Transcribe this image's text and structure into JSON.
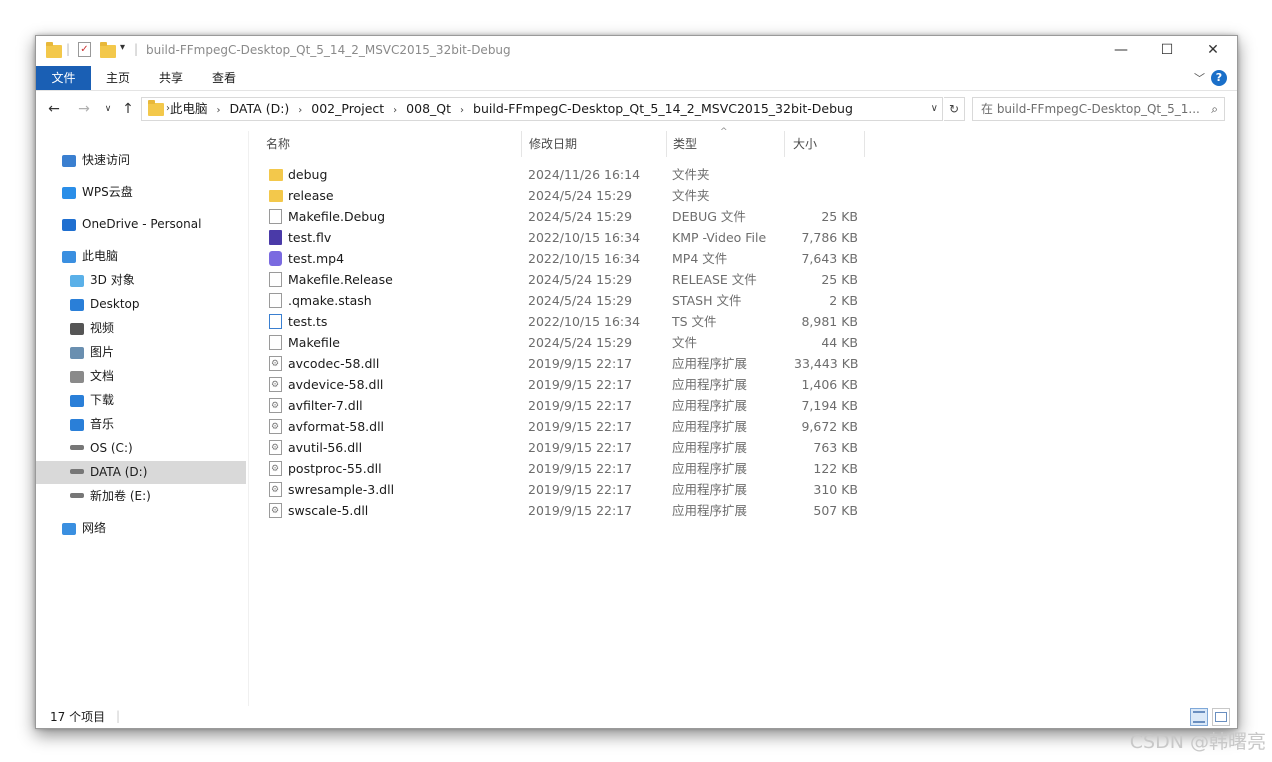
{
  "window": {
    "title": "build-FFmpegC-Desktop_Qt_5_14_2_MSVC2015_32bit-Debug",
    "controls": {
      "minimize": "—",
      "maximize": "☐",
      "close": "✕"
    }
  },
  "ribbon": {
    "tabs": [
      {
        "label": "文件",
        "active": true
      },
      {
        "label": "主页"
      },
      {
        "label": "共享"
      },
      {
        "label": "查看"
      }
    ],
    "help": "?"
  },
  "address": {
    "crumbs": [
      "此电脑",
      "DATA (D:)",
      "002_Project",
      "008_Qt",
      "build-FFmpegC-Desktop_Qt_5_14_2_MSVC2015_32bit-Debug"
    ],
    "search_placeholder": "在 build-FFmpegC-Desktop_Qt_5_1..."
  },
  "sidebar": {
    "items": [
      {
        "label": "快速访问",
        "icon": "star-icon"
      },
      {
        "label": "WPS云盘",
        "icon": "cloud-icon"
      },
      {
        "label": "OneDrive - Personal",
        "icon": "onedrive-icon"
      },
      {
        "label": "此电脑",
        "icon": "computer-icon"
      },
      {
        "label": "3D 对象",
        "icon": "3d-objects-icon"
      },
      {
        "label": "Desktop",
        "icon": "desktop-icon"
      },
      {
        "label": "视频",
        "icon": "video-icon"
      },
      {
        "label": "图片",
        "icon": "pictures-icon"
      },
      {
        "label": "文档",
        "icon": "documents-icon"
      },
      {
        "label": "下载",
        "icon": "download-icon"
      },
      {
        "label": "音乐",
        "icon": "music-icon"
      },
      {
        "label": "OS (C:)",
        "icon": "drive-icon"
      },
      {
        "label": "DATA (D:)",
        "icon": "drive-icon",
        "selected": true
      },
      {
        "label": "新加卷 (E:)",
        "icon": "drive-icon"
      },
      {
        "label": "网络",
        "icon": "network-icon"
      }
    ]
  },
  "columns": {
    "name": "名称",
    "date": "修改日期",
    "type": "类型",
    "size": "大小"
  },
  "files": [
    {
      "name": "debug",
      "date": "2024/11/26 16:14",
      "type": "文件夹",
      "size": "",
      "icon": "folder"
    },
    {
      "name": "release",
      "date": "2024/5/24 15:29",
      "type": "文件夹",
      "size": "",
      "icon": "folder"
    },
    {
      "name": "Makefile.Debug",
      "date": "2024/5/24 15:29",
      "type": "DEBUG 文件",
      "size": "25 KB",
      "icon": "doc"
    },
    {
      "name": "test.flv",
      "date": "2022/10/15 16:34",
      "type": "KMP -Video File",
      "size": "7,786 KB",
      "icon": "flv"
    },
    {
      "name": "test.mp4",
      "date": "2022/10/15 16:34",
      "type": "MP4 文件",
      "size": "7,643 KB",
      "icon": "mp4"
    },
    {
      "name": "Makefile.Release",
      "date": "2024/5/24 15:29",
      "type": "RELEASE 文件",
      "size": "25 KB",
      "icon": "doc"
    },
    {
      "name": ".qmake.stash",
      "date": "2024/5/24 15:29",
      "type": "STASH 文件",
      "size": "2 KB",
      "icon": "doc"
    },
    {
      "name": "test.ts",
      "date": "2022/10/15 16:34",
      "type": "TS 文件",
      "size": "8,981 KB",
      "icon": "ts"
    },
    {
      "name": "Makefile",
      "date": "2024/5/24 15:29",
      "type": "文件",
      "size": "44 KB",
      "icon": "doc"
    },
    {
      "name": "avcodec-58.dll",
      "date": "2019/9/15 22:17",
      "type": "应用程序扩展",
      "size": "33,443 KB",
      "icon": "dll"
    },
    {
      "name": "avdevice-58.dll",
      "date": "2019/9/15 22:17",
      "type": "应用程序扩展",
      "size": "1,406 KB",
      "icon": "dll"
    },
    {
      "name": "avfilter-7.dll",
      "date": "2019/9/15 22:17",
      "type": "应用程序扩展",
      "size": "7,194 KB",
      "icon": "dll"
    },
    {
      "name": "avformat-58.dll",
      "date": "2019/9/15 22:17",
      "type": "应用程序扩展",
      "size": "9,672 KB",
      "icon": "dll"
    },
    {
      "name": "avutil-56.dll",
      "date": "2019/9/15 22:17",
      "type": "应用程序扩展",
      "size": "763 KB",
      "icon": "dll"
    },
    {
      "name": "postproc-55.dll",
      "date": "2019/9/15 22:17",
      "type": "应用程序扩展",
      "size": "122 KB",
      "icon": "dll"
    },
    {
      "name": "swresample-3.dll",
      "date": "2019/9/15 22:17",
      "type": "应用程序扩展",
      "size": "310 KB",
      "icon": "dll"
    },
    {
      "name": "swscale-5.dll",
      "date": "2019/9/15 22:17",
      "type": "应用程序扩展",
      "size": "507 KB",
      "icon": "dll"
    }
  ],
  "status": {
    "count": "17 个项目"
  },
  "watermark": "CSDN @韩曙亮",
  "colors": {
    "accent": "#1a5fb4",
    "folder": "#f3c84b",
    "selected": "#d9d9d9"
  }
}
